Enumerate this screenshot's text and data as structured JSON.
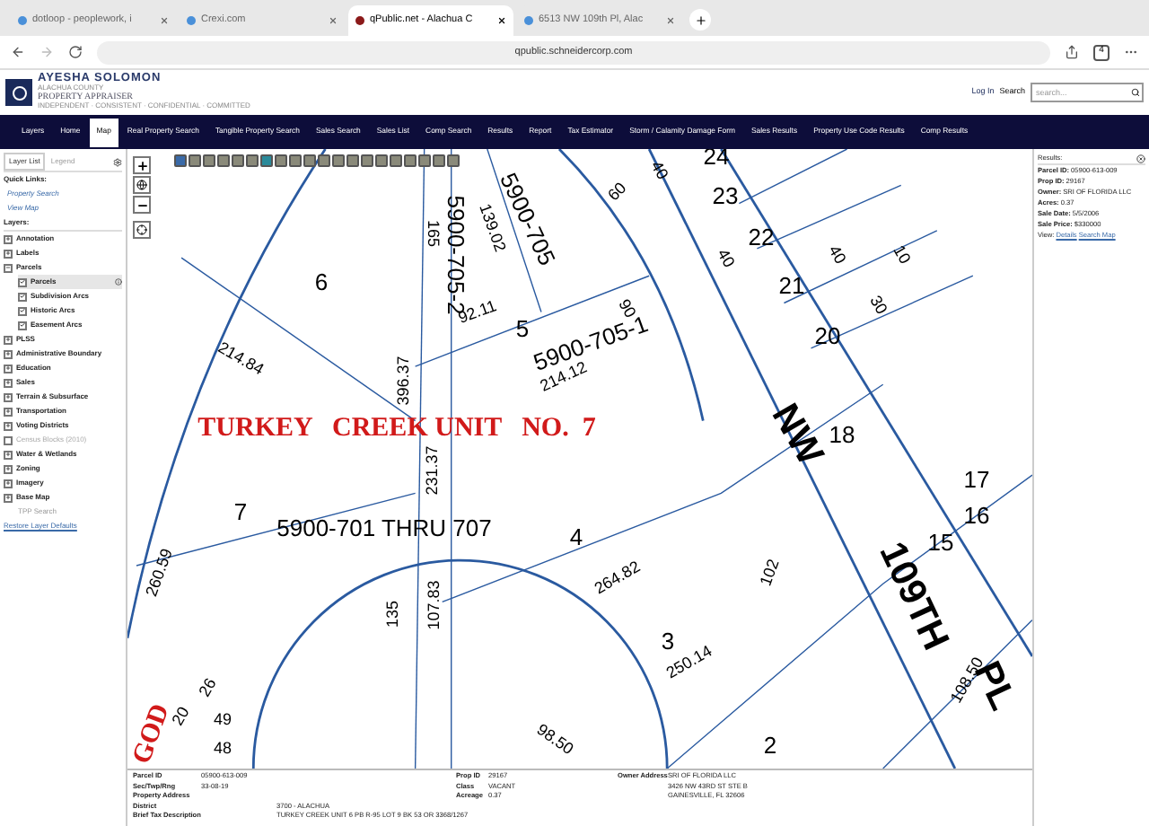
{
  "browser": {
    "tabs": [
      {
        "title": "dotloop - peoplework, i",
        "selected": false
      },
      {
        "title": "Crexi.com",
        "selected": false
      },
      {
        "title": "qPublic.net - Alachua C",
        "selected": true
      },
      {
        "title": "6513 NW 109th Pl, Alac",
        "selected": false
      }
    ],
    "url": "qpublic.schneidercorp.com",
    "tab_count": "4"
  },
  "header": {
    "name": "AYESHA SOLOMON",
    "county": "ALACHUA COUNTY",
    "title": "PROPERTY APPRAISER",
    "tagline": "INDEPENDENT · CONSISTENT · CONFIDENTIAL · COMMITTED",
    "login": "Log In",
    "search_label": "Search",
    "search_placeholder": "search..."
  },
  "nav": [
    {
      "label": "Layers",
      "selected": false
    },
    {
      "label": "Home",
      "selected": false
    },
    {
      "label": "Map",
      "selected": true
    },
    {
      "label": "Real Property Search",
      "selected": false
    },
    {
      "label": "Tangible Property Search",
      "selected": false
    },
    {
      "label": "Sales Search",
      "selected": false
    },
    {
      "label": "Sales List",
      "selected": false
    },
    {
      "label": "Comp Search",
      "selected": false
    },
    {
      "label": "Results",
      "selected": false
    },
    {
      "label": "Report",
      "selected": false
    },
    {
      "label": "Tax Estimator",
      "selected": false
    },
    {
      "label": "Storm / Calamity Damage Form",
      "selected": false
    },
    {
      "label": "Sales Results",
      "selected": false
    },
    {
      "label": "Property Use Code Results",
      "selected": false
    },
    {
      "label": "Comp Results",
      "selected": false
    }
  ],
  "sidebar": {
    "tabs": [
      {
        "label": "Layer List",
        "selected": true
      },
      {
        "label": "Legend",
        "selected": false
      }
    ],
    "quick_links_title": "Quick Links:",
    "quick_links": [
      "Property Search",
      "View Map"
    ],
    "layers_title": "Layers:",
    "layers": [
      {
        "kind": "group",
        "label": "Annotation",
        "expanded": false
      },
      {
        "kind": "group",
        "label": "Labels",
        "expanded": false
      },
      {
        "kind": "group",
        "label": "Parcels",
        "expanded": true,
        "children": [
          {
            "kind": "check",
            "label": "Parcels",
            "checked": true,
            "selected": true
          },
          {
            "kind": "check",
            "label": "Subdivision Arcs",
            "checked": true,
            "selected": false
          },
          {
            "kind": "check",
            "label": "Historic Arcs",
            "checked": true,
            "selected": false
          },
          {
            "kind": "check",
            "label": "Easement Arcs",
            "checked": true,
            "selected": false
          }
        ]
      },
      {
        "kind": "group",
        "label": "PLSS",
        "expanded": false
      },
      {
        "kind": "group",
        "label": "Administrative Boundary",
        "expanded": false
      },
      {
        "kind": "group",
        "label": "Education",
        "expanded": false
      },
      {
        "kind": "group",
        "label": "Sales",
        "expanded": false
      },
      {
        "kind": "group",
        "label": "Terrain & Subsurface",
        "expanded": false
      },
      {
        "kind": "group",
        "label": "Transportation",
        "expanded": false
      },
      {
        "kind": "group",
        "label": "Voting Districts",
        "expanded": false
      },
      {
        "kind": "check",
        "label": "Census Blocks (2010)",
        "checked": false,
        "disabled": true
      },
      {
        "kind": "group",
        "label": "Water & Wetlands",
        "expanded": false
      },
      {
        "kind": "group",
        "label": "Zoning",
        "expanded": false
      },
      {
        "kind": "group",
        "label": "Imagery",
        "expanded": false
      },
      {
        "kind": "group",
        "label": "Base Map",
        "expanded": false
      },
      {
        "kind": "text",
        "label": "TPP Search"
      }
    ],
    "restore": "Restore Layer Defaults"
  },
  "map": {
    "labels": [
      {
        "text": "6",
        "kind": "lot"
      },
      {
        "text": "165",
        "kind": "dim"
      },
      {
        "text": "5900-705-2",
        "kind": "lot"
      },
      {
        "text": "139.02",
        "kind": "dim"
      },
      {
        "text": "5900-705",
        "kind": "lot"
      },
      {
        "text": "60",
        "kind": "dim"
      },
      {
        "text": "24",
        "kind": "lot"
      },
      {
        "text": "23",
        "kind": "lot"
      },
      {
        "text": "22",
        "kind": "lot"
      },
      {
        "text": "21",
        "kind": "lot"
      },
      {
        "text": "40",
        "kind": "dim"
      },
      {
        "text": "40",
        "kind": "dim"
      },
      {
        "text": "40",
        "kind": "dim"
      },
      {
        "text": "10",
        "kind": "dim"
      },
      {
        "text": "30",
        "kind": "dim"
      },
      {
        "text": "20",
        "kind": "lot"
      },
      {
        "text": "18",
        "kind": "lot"
      },
      {
        "text": "17",
        "kind": "lot"
      },
      {
        "text": "16",
        "kind": "lot"
      },
      {
        "text": "15",
        "kind": "lot"
      },
      {
        "text": "92.11",
        "kind": "dim"
      },
      {
        "text": "5",
        "kind": "lot"
      },
      {
        "text": "90",
        "kind": "dim"
      },
      {
        "text": "5900-705-1",
        "kind": "lot"
      },
      {
        "text": "214.84",
        "kind": "dim"
      },
      {
        "text": "396.37",
        "kind": "dim"
      },
      {
        "text": "TURKEY   CREEK UNIT   NO.  7",
        "kind": "title"
      },
      {
        "text": "231.37",
        "kind": "dim"
      },
      {
        "text": "214.12",
        "kind": "dim"
      },
      {
        "text": "NW",
        "kind": "street"
      },
      {
        "text": "109TH",
        "kind": "street"
      },
      {
        "text": "PL",
        "kind": "street"
      },
      {
        "text": "7",
        "kind": "lot"
      },
      {
        "text": "5900-701 THRU 707",
        "kind": "lot"
      },
      {
        "text": "4",
        "kind": "lot"
      },
      {
        "text": "264.82",
        "kind": "dim"
      },
      {
        "text": "102",
        "kind": "dim"
      },
      {
        "text": "135",
        "kind": "dim"
      },
      {
        "text": "107.83",
        "kind": "dim"
      },
      {
        "text": "260.59",
        "kind": "dim"
      },
      {
        "text": "3",
        "kind": "lot"
      },
      {
        "text": "250.14",
        "kind": "dim"
      },
      {
        "text": "108.50",
        "kind": "dim"
      },
      {
        "text": "98.50",
        "kind": "dim"
      },
      {
        "text": "2",
        "kind": "lot"
      },
      {
        "text": "GOD",
        "kind": "title"
      },
      {
        "text": "49",
        "kind": "dim"
      },
      {
        "text": "48",
        "kind": "dim"
      },
      {
        "text": "26",
        "kind": "dim"
      },
      {
        "text": "20",
        "kind": "dim"
      }
    ]
  },
  "results": {
    "title": "Results:",
    "rows": [
      {
        "label": "Parcel ID:",
        "value": "05900-613-009"
      },
      {
        "label": "Prop ID:",
        "value": "29167"
      },
      {
        "label": "Owner:",
        "value": "SRI OF FLORIDA LLC"
      },
      {
        "label": "Acres:",
        "value": "0.37"
      },
      {
        "label": "Sale Date:",
        "value": "5/5/2006"
      },
      {
        "label": "Sale Price:",
        "value": "$330000"
      }
    ],
    "view_label": "View:",
    "view_links": [
      "Details",
      "Search Map"
    ]
  },
  "info": {
    "left": [
      {
        "label": "Parcel ID",
        "value": "05900-613-009"
      },
      {
        "label": "Sec/Twp/Rng",
        "value": "33-08-19"
      },
      {
        "label": "Property Address"
      }
    ],
    "middle": [
      {
        "label": "Prop ID",
        "value": "29167"
      },
      {
        "label": "Class",
        "value": "VACANT"
      },
      {
        "label": "Acreage",
        "value": "0.37"
      }
    ],
    "owner_label": "Owner Address",
    "owner_lines": [
      "SRI OF FLORIDA LLC",
      "3426 NW 43RD ST STE B",
      "GAINESVILLE, FL 32606"
    ],
    "wide": [
      {
        "label": "District",
        "value": "3700 - ALACHUA"
      },
      {
        "label": "Brief Tax Description",
        "value": "TURKEY CREEK UNIT 6 PB R-95 LOT 9 BK 53 OR 3368/1267"
      }
    ]
  }
}
